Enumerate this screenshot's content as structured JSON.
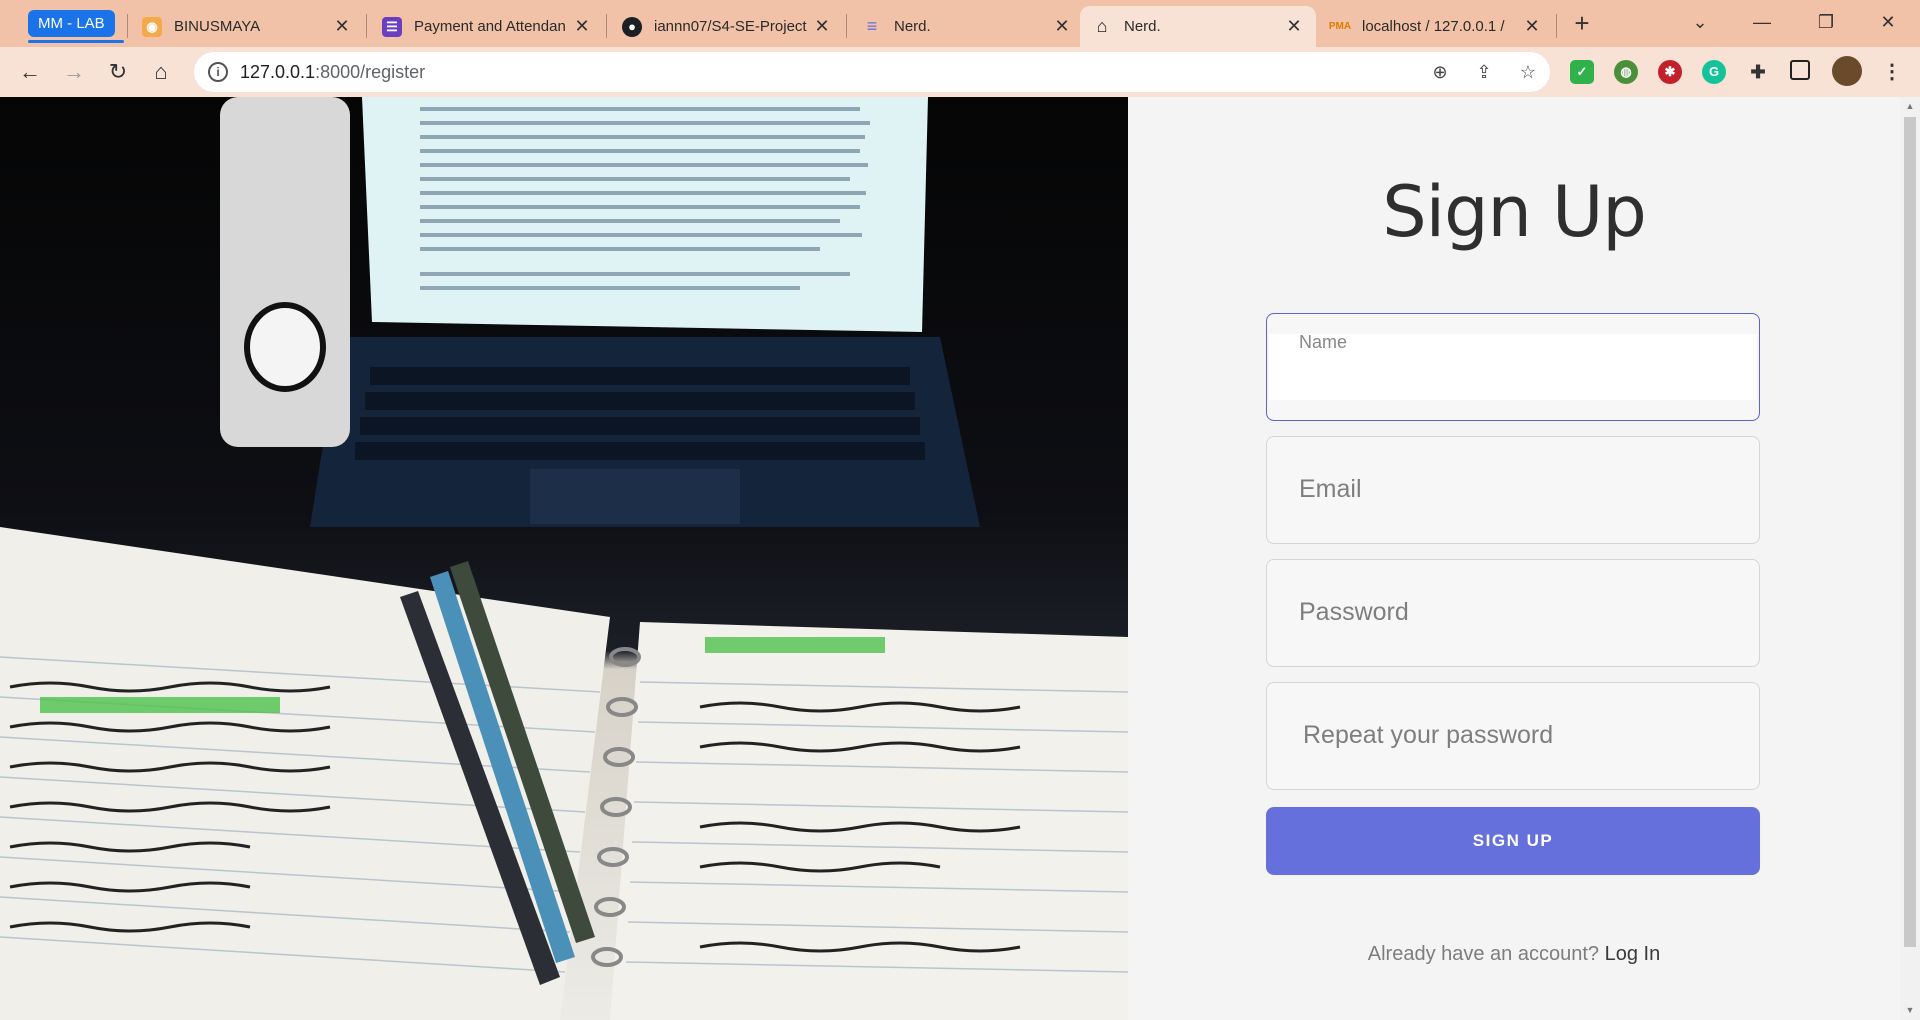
{
  "tabs": {
    "group_label": "MM - LAB",
    "items": [
      {
        "title": "BINUSMAYA",
        "icon": "binusmaya-icon"
      },
      {
        "title": "Payment and Attendan",
        "icon": "forms-icon"
      },
      {
        "title": "iannn07/S4-SE-Project",
        "icon": "github-icon"
      },
      {
        "title": "Nerd.",
        "icon": "nerd-icon"
      },
      {
        "title": "Nerd.",
        "icon": "home-icon"
      },
      {
        "title": "localhost / 127.0.0.1 /",
        "icon": "phpmyadmin-icon"
      }
    ],
    "new_tab": "+"
  },
  "toolbar": {
    "url_host": "127.0.0.1",
    "url_rest": ":8000/register"
  },
  "form": {
    "title": "Sign Up",
    "name_placeholder": "Name",
    "email_placeholder": "Email",
    "password_placeholder": "Password",
    "repeat_placeholder": "Repeat your password",
    "submit_label": "SIGN UP",
    "footer_text": "Already have an account?",
    "login_link": "Log In"
  },
  "colors": {
    "tab_bar": "#f2c2a8",
    "toolbar": "#f7e2d5",
    "accent": "#6570dc",
    "group_chip": "#1a73e8"
  }
}
